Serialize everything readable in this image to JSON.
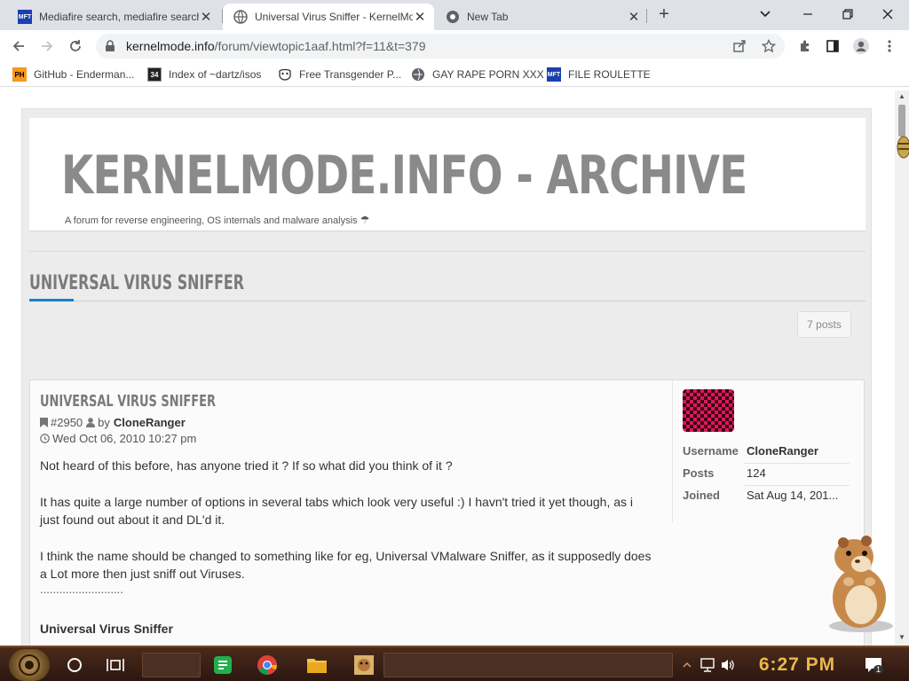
{
  "browser": {
    "tabs": [
      {
        "title": "Mediafire search, mediafire search",
        "favicon": "mft-icon"
      },
      {
        "title": "Universal Virus Sniffer - KernelMode",
        "favicon": "globe-icon",
        "active": true
      },
      {
        "title": "New Tab",
        "favicon": "chrome-icon"
      }
    ],
    "url_domain": "kernelmode.info",
    "url_path": "/forum/viewtopic1aaf.html?f=11&t=379",
    "bookmarks": [
      {
        "label": "GitHub - Enderman...",
        "icon": "ph"
      },
      {
        "label": "Index of ~dartz/isos",
        "icon": "34"
      },
      {
        "label": "Free Transgender P...",
        "icon": "mask"
      },
      {
        "label": "GAY RAPE PORN XXX",
        "icon": "globe"
      },
      {
        "label": "FILE ROULETTE",
        "icon": "mft"
      }
    ],
    "mft_label": "MFT",
    "ph_label": "PH",
    "n34_label": "34"
  },
  "site": {
    "title": "KERNELMODE.INFO - ARCHIVE",
    "description": "A forum for reverse engineering, OS internals and malware analysis"
  },
  "topic": {
    "title": "UNIVERSAL VIRUS SNIFFER",
    "posts_count": "7 posts"
  },
  "post": {
    "title": "UNIVERSAL VIRUS SNIFFER",
    "id": "#2950",
    "by": "by",
    "author": "CloneRanger",
    "date": "Wed Oct 06, 2010 10:27 pm",
    "paragraphs": [
      "Not heard of this before, has anyone tried it ? If so what did you think of it ?",
      "It has quite a large number of options in several tabs which look very useful :) I havn't tried it yet though, as i just found out about it and DL'd it.",
      "I think the name should be changed to something like for eg, Universal VMalware Sniffer, as it supposedly does a Lot more then just sniff out Viruses."
    ],
    "dots": "..........................",
    "subheading": "Universal Virus Sniffer"
  },
  "profile": {
    "username_label": "Username",
    "username": "CloneRanger",
    "posts_label": "Posts",
    "posts": "124",
    "joined_label": "Joined",
    "joined": "Sat Aug 14, 201..."
  },
  "taskbar": {
    "clock": "6:27 PM",
    "notification_count": "1"
  },
  "colors": {
    "accent": "#1a82c4",
    "title_gray": "#8a8a8a",
    "clock": "#e9b84a"
  }
}
